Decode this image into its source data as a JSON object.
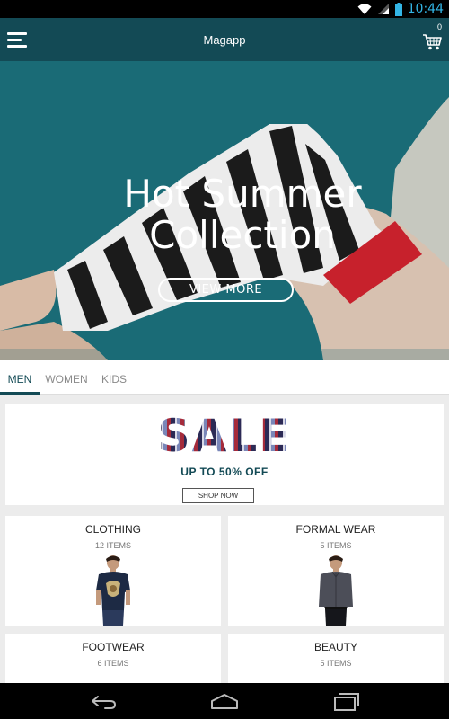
{
  "status_bar": {
    "time": "10:44",
    "icons": [
      "wifi-icon",
      "signal-icon",
      "battery-icon"
    ]
  },
  "app_bar": {
    "title": "Magapp",
    "cart_count": "0",
    "menu_icon": "menu-icon",
    "cart_icon": "cart-icon"
  },
  "hero": {
    "title_line1": "Hot Summer",
    "title_line2": "Collection",
    "button_label": "VIEW MORE"
  },
  "tabs": [
    {
      "label": "MEN",
      "active": true
    },
    {
      "label": "WOMEN",
      "active": false
    },
    {
      "label": "KIDS",
      "active": false
    }
  ],
  "sale_banner": {
    "headline": "SALE",
    "subtitle": "UP TO 50% OFF",
    "button_label": "SHOP NOW"
  },
  "categories": [
    {
      "name": "CLOTHING",
      "count": "12 ITEMS"
    },
    {
      "name": "FORMAL WEAR",
      "count": "5 ITEMS"
    },
    {
      "name": "FOOTWEAR",
      "count": "6 ITEMS"
    },
    {
      "name": "BEAUTY",
      "count": "5 ITEMS"
    }
  ],
  "nav_bar": {
    "icons": [
      "back-icon",
      "home-icon",
      "recent-apps-icon"
    ]
  },
  "colors": {
    "accent": "#134a55",
    "hero_bg": "#1a6b76",
    "status_time": "#33b5e5"
  }
}
